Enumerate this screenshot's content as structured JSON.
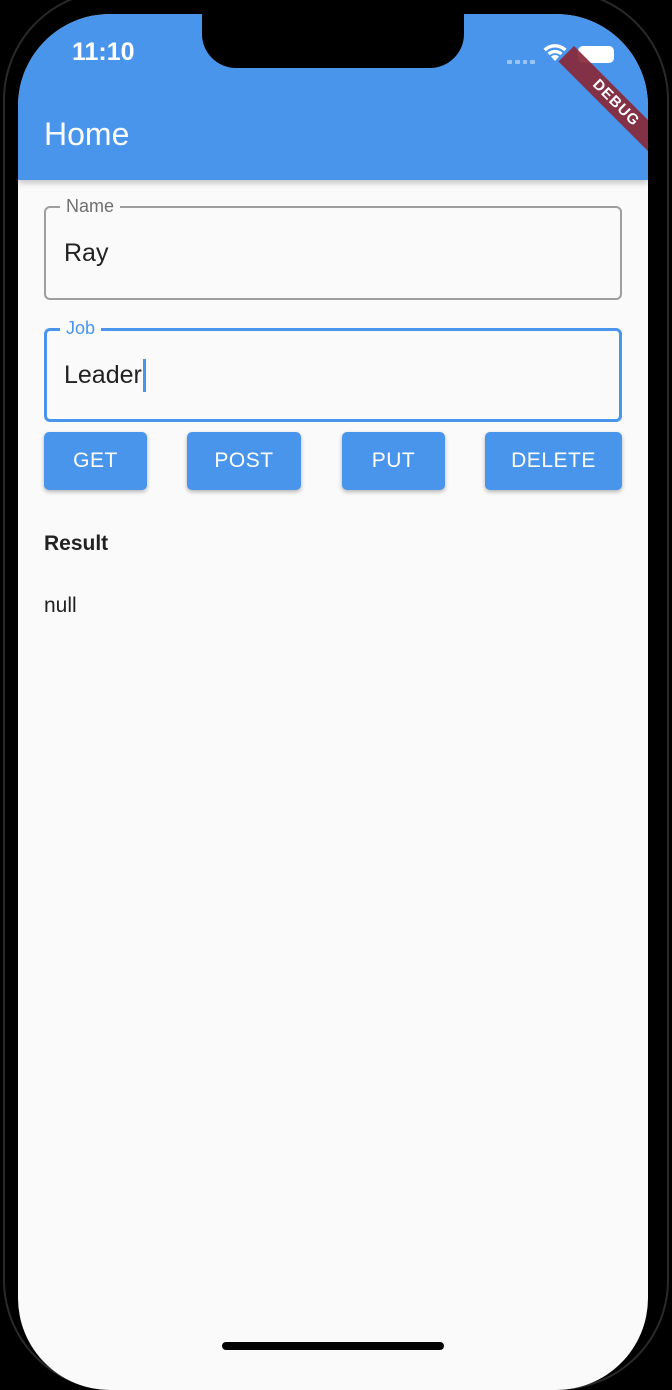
{
  "status_bar": {
    "time": "11:10"
  },
  "debug_banner": "DEBUG",
  "app_bar": {
    "title": "Home"
  },
  "form": {
    "name": {
      "label": "Name",
      "value": "Ray"
    },
    "job": {
      "label": "Job",
      "value": "Leader"
    }
  },
  "buttons": {
    "get": "GET",
    "post": "POST",
    "put": "PUT",
    "delete": "DELETE"
  },
  "result": {
    "label": "Result",
    "value": "null"
  },
  "colors": {
    "primary": "#4a95ec",
    "background": "#fafafa",
    "debug": "#882838"
  }
}
